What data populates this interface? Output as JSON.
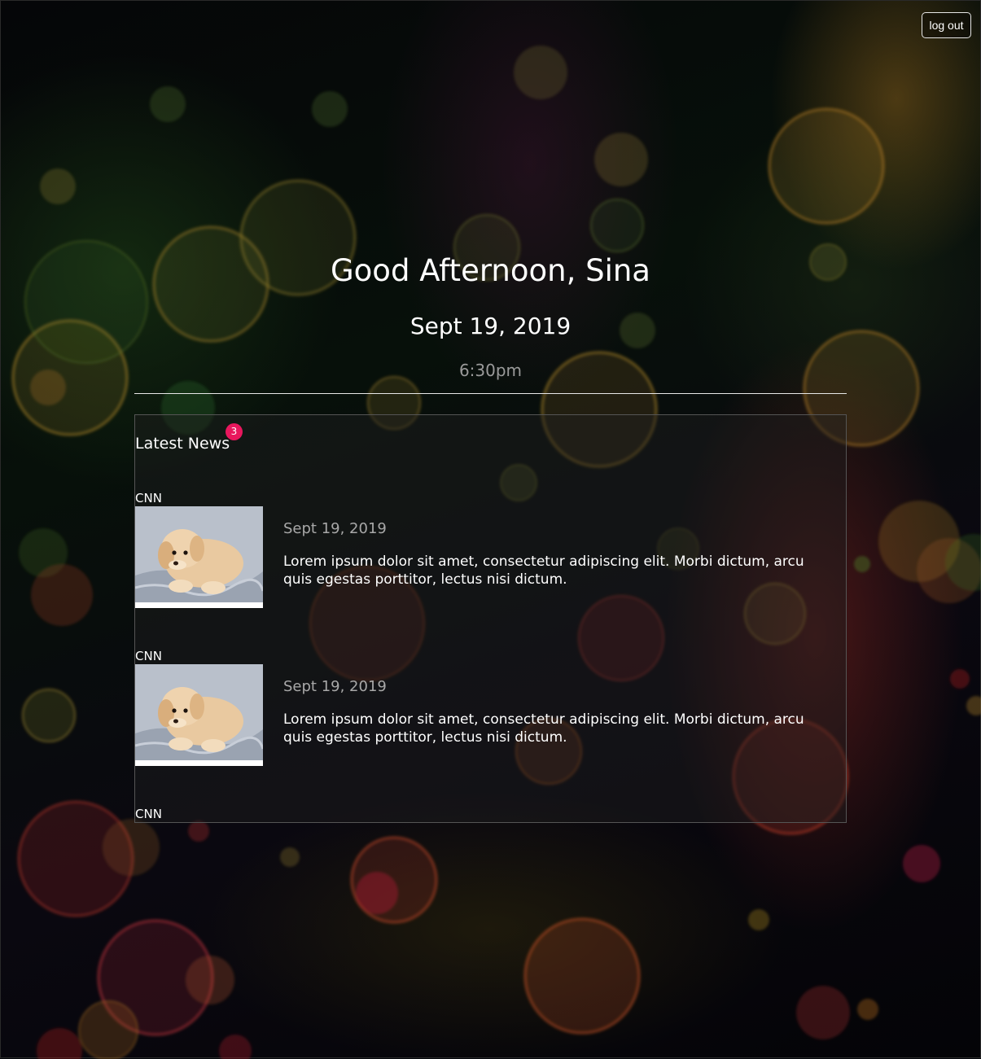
{
  "header": {
    "logout_label": "log out"
  },
  "hero": {
    "greeting": "Good Afternoon, Sina",
    "date": "Sept 19, 2019",
    "time": "6:30pm"
  },
  "news": {
    "title": "Latest News",
    "badge_count": "3",
    "articles": [
      {
        "source": "CNN",
        "date": "Sept 19, 2019",
        "text": "Lorem ipsum dolor sit amet, consectetur adipiscing elit. Morbi dictum, arcu quis egestas porttitor, lectus nisi dictum."
      },
      {
        "source": "CNN",
        "date": "Sept 19, 2019",
        "text": "Lorem ipsum dolor sit amet, consectetur adipiscing elit. Morbi dictum, arcu quis egestas porttitor, lectus nisi dictum."
      },
      {
        "source": "CNN"
      }
    ]
  },
  "colors": {
    "badge": "#e8175d",
    "muted_text": "#9a9a9a"
  }
}
